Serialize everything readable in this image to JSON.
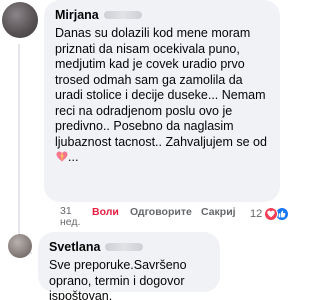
{
  "comments": [
    {
      "author": "Mirjana",
      "text": "Danas su dolazili kod mene moram priznati da nisam ocekivala puno, medjutim kad je covek uradio prvo trosed odmah sam ga zamolila da uradi stolice i decije duseke... Nemam reci na odradjenom poslu ovo je predivno.. Posebno da naglasim ljubaznost tacnost.. Zahvaljujem se od",
      "text_tail": "...",
      "emoji": "heart-with-ribbon-emoji",
      "time": "31 нед.",
      "like_label": "Воли",
      "reply_label": "Одговорите",
      "hide_label": "Сакриј",
      "reaction_count": "12",
      "reactions": [
        "heart-react-icon",
        "like-react-icon"
      ],
      "like_color": "#e41e3f"
    },
    {
      "author": "Svetlana",
      "text": "Sve preporuke.Savršeno oprano, termin i dogovor ispoštovan."
    }
  ],
  "colors": {
    "bubble_bg": "#f0f2f5",
    "meta_text": "#65676b",
    "heart_react": "#f33e58",
    "like_react": "#1877f2"
  }
}
